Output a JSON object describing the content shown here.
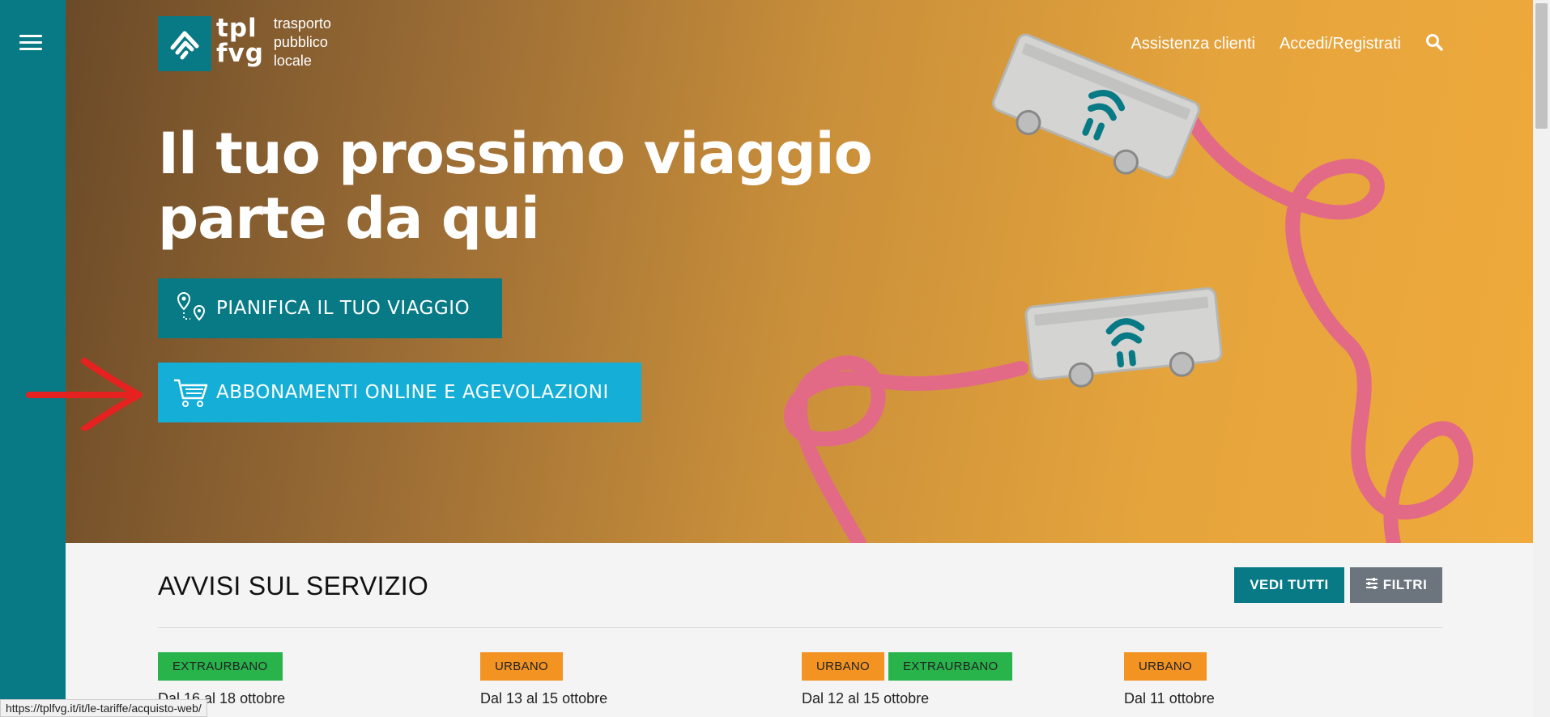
{
  "logo": {
    "line1": "tpl",
    "line2": "fvg",
    "sub1": "trasporto",
    "sub2": "pubblico",
    "sub3": "locale"
  },
  "nav": {
    "support": "Assistenza clienti",
    "login": "Accedi/Registrati"
  },
  "hero": {
    "title_line1": "Il tuo prossimo viaggio",
    "title_line2": "parte da qui",
    "plan_button": "PIANIFICA IL TUO VIAGGIO",
    "subscriptions_button": "ABBONAMENTI ONLINE E AGEVOLAZIONI"
  },
  "notices": {
    "title": "AVVISI SUL SERVIZIO",
    "view_all": "VEDI TUTTI",
    "filters": "FILTRI",
    "items": [
      {
        "badges": [
          "EXTRAURBANO"
        ],
        "date": "Dal 16 al 18 ottobre"
      },
      {
        "badges": [
          "URBANO"
        ],
        "date": "Dal 13 al 15 ottobre"
      },
      {
        "badges": [
          "URBANO",
          "EXTRAURBANO"
        ],
        "date": "Dal 12 al 15 ottobre"
      },
      {
        "badges": [
          "URBANO"
        ],
        "date": "Dal 11 ottobre"
      }
    ]
  },
  "status_url": "https://tplfvg.it/it/le-tariffe/acquisto-web/",
  "colors": {
    "teal": "#077a85",
    "cyan": "#14aed6",
    "green": "#28b34b",
    "orange": "#f39422",
    "grey": "#6c757d"
  },
  "icons": [
    "menu-icon",
    "search-icon",
    "route-pin-icon",
    "cart-icon",
    "filter-icon",
    "arrow-annotation"
  ]
}
